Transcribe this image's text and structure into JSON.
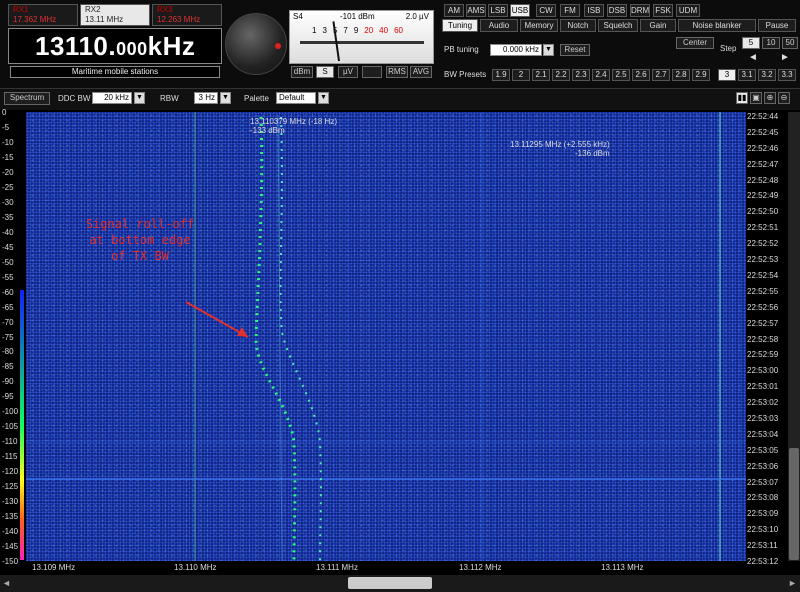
{
  "receivers": [
    {
      "title": "RX1",
      "freq": "17.362 MHz",
      "active": false
    },
    {
      "title": "RX2",
      "freq": "13.11 MHz",
      "active": true
    },
    {
      "title": "RX3",
      "freq": "12.263 MHz",
      "active": false
    }
  ],
  "frequency": {
    "main": "13110.",
    "fraction": "000",
    "unit": "kHz"
  },
  "station": "Maritime mobile stations",
  "smeter": {
    "s_reading": "S4",
    "dbm": "-101 dBm",
    "uv": "2.0 µV",
    "scale": [
      "1",
      "3",
      "5",
      "7",
      "9"
    ],
    "scale_over": [
      "20",
      "40",
      "60"
    ],
    "buttons": [
      "dBm",
      "S",
      "µV",
      "RMS",
      "AVG"
    ]
  },
  "modes": [
    "AM",
    "AMS",
    "LSB",
    "USB",
    "CW",
    "FM",
    "ISB",
    "DSB",
    "DRM",
    "FSK",
    "UDM"
  ],
  "active_mode": "USB",
  "function_tabs": [
    "Tuning",
    "Audio",
    "Memory",
    "Notch",
    "Squelch",
    "Gain",
    "Noise blanker",
    "Pause"
  ],
  "active_tab": "Tuning",
  "pb_tuning": {
    "label": "PB tuning",
    "value": "0.000 kHz",
    "reset": "Reset"
  },
  "center": {
    "label": "Center",
    "step_label": "Step",
    "steps": [
      "5",
      "10",
      "50"
    ],
    "left_arrow": "◄",
    "right_arrow": "►"
  },
  "bw_presets": {
    "label": "BW Presets",
    "values": [
      "1.9",
      "2",
      "2.1",
      "2.2",
      "2.3",
      "2.4",
      "2.5",
      "2.6",
      "2.7",
      "2.8",
      "2.9",
      "3",
      "3.1",
      "3.2",
      "3.3"
    ],
    "active": "3"
  },
  "controls": {
    "spectrum": "Spectrum",
    "ddc_bw_label": "DDC BW",
    "ddc_bw_value": "20 kHz",
    "rbw_label": "RBW",
    "rbw_value": "3 Hz",
    "palette_label": "Palette",
    "palette_value": "Default"
  },
  "waterfall": {
    "db_ticks": [
      "0",
      "-5",
      "-10",
      "-15",
      "-20",
      "-25",
      "-30",
      "-35",
      "-40",
      "-45",
      "-50",
      "-55",
      "-60",
      "-65",
      "-70",
      "-75",
      "-80",
      "-85",
      "-90",
      "-95",
      "-100",
      "-105",
      "-110",
      "-115",
      "-120",
      "-125",
      "-130",
      "-135",
      "-140",
      "-145",
      "-150"
    ],
    "time_ticks": [
      "22:52:44",
      "22:52:45",
      "22:52:46",
      "22:52:47",
      "22:52:48",
      "22:52:49",
      "22:52:50",
      "22:52:51",
      "22:52:52",
      "22:52:53",
      "22:52:54",
      "22:52:55",
      "22:52:56",
      "22:52:57",
      "22:52:58",
      "22:52:59",
      "22:53:00",
      "22:53:01",
      "22:53:02",
      "22:53:03",
      "22:53:04",
      "22:53:05",
      "22:53:06",
      "22:53:07",
      "22:53:08",
      "22:53:09",
      "22:53:10",
      "22:53:11",
      "22:53:12"
    ],
    "freq_ticks": [
      "13.109 MHz",
      "13.110 MHz",
      "13.111 MHz",
      "13.112 MHz",
      "13.113 MHz"
    ],
    "marker1": {
      "freq": "13.110379 MHz (-18 Hz)",
      "level": "-133 dBm"
    },
    "marker2": {
      "freq": "13.11295 MHz (+2.555 kHz)",
      "level": "-136 dBm"
    },
    "annotation": "Signal roll-off\nat bottom edge\nof TX BW"
  },
  "colors": {
    "annotation": "#e03030",
    "waterfall_bg": "#0a1a7a",
    "signal": "#30ff80"
  }
}
